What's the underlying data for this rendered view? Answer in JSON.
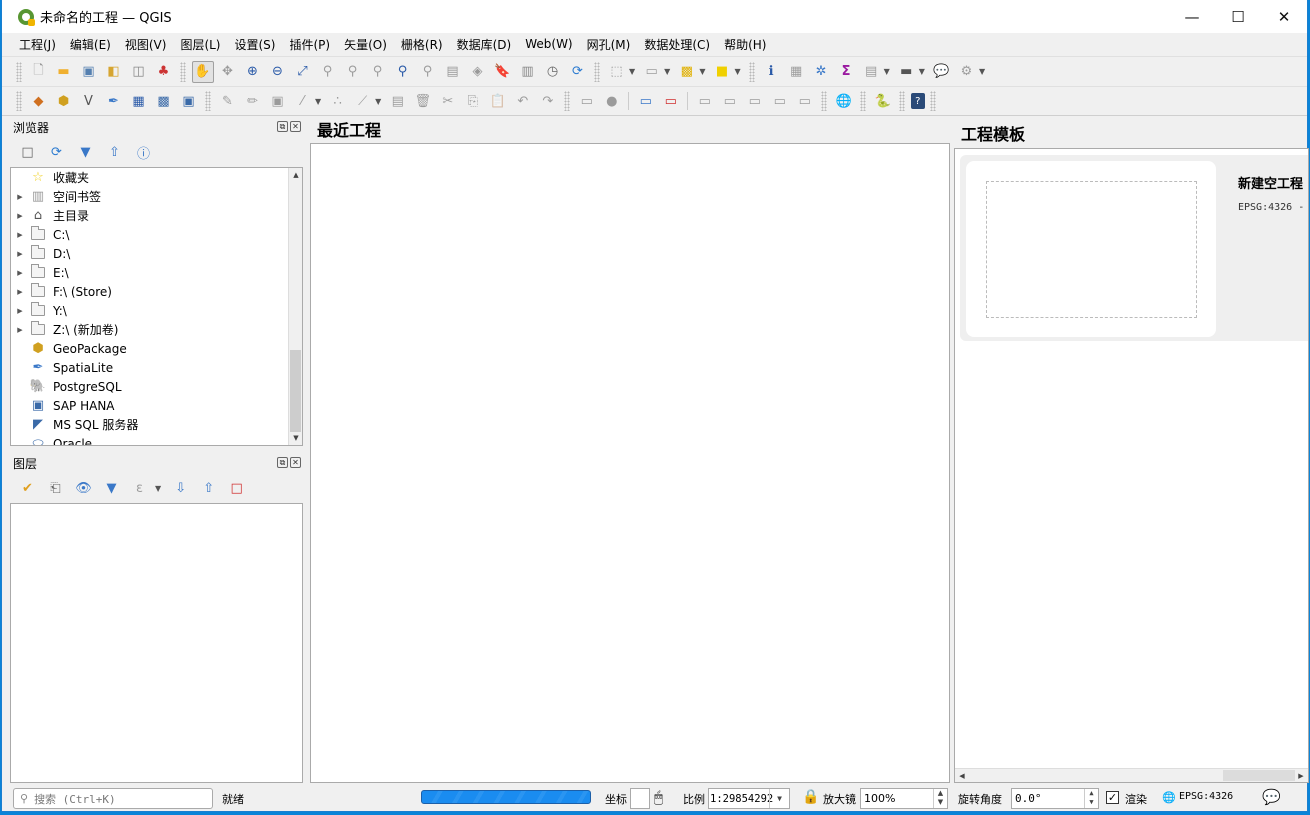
{
  "window": {
    "title": "未命名的工程 — QGIS",
    "controls": {
      "minimize": "—",
      "maximize": "☐",
      "close": "✕"
    }
  },
  "menubar": {
    "items": [
      {
        "label": "工程(J)"
      },
      {
        "label": "编辑(E)"
      },
      {
        "label": "视图(V)"
      },
      {
        "label": "图层(L)"
      },
      {
        "label": "设置(S)"
      },
      {
        "label": "插件(P)"
      },
      {
        "label": "矢量(O)"
      },
      {
        "label": "栅格(R)"
      },
      {
        "label": "数据库(D)"
      },
      {
        "label": "Web(W)"
      },
      {
        "label": "网孔(M)"
      },
      {
        "label": "数据处理(C)"
      },
      {
        "label": "帮助(H)"
      }
    ]
  },
  "toolbar1": {
    "icons": [
      "new-project-icon",
      "open-project-icon",
      "save-project-icon",
      "save-as-icon",
      "print-layout-icon",
      "style-manager-icon",
      "pan-icon",
      "pan-to-selection-icon",
      "zoom-in-icon",
      "zoom-out-icon",
      "zoom-full-icon",
      "zoom-to-selection-icon",
      "zoom-to-layer-icon",
      "zoom-native-icon",
      "zoom-last-icon",
      "zoom-next-icon",
      "new-map-view-icon",
      "new-3d-view-icon",
      "new-bookmark-icon",
      "show-bookmarks-icon",
      "temporal-controller-icon",
      "refresh-icon",
      "select-features-icon",
      "deselect-icon",
      "select-by-location-icon",
      "annotation-icon",
      "identify-icon",
      "attribute-table-icon",
      "processing-toolbox-icon",
      "statistics-icon",
      "open-field-calculator-icon",
      "measure-icon",
      "map-tips-icon",
      "locator-icon"
    ]
  },
  "toolbar2": {
    "icons": [
      "add-vector-layer-icon",
      "add-geopackage-icon",
      "add-delimited-text-icon",
      "add-spatialite-icon",
      "add-mesh-icon",
      "add-raster-icon",
      "add-virtual-layer-icon",
      "current-edits-icon",
      "toggle-editing-icon",
      "save-edits-icon",
      "digitize-icon",
      "add-point-icon",
      "vertex-tool-icon",
      "modify-attributes-icon",
      "delete-selected-icon",
      "cut-features-icon",
      "copy-features-icon",
      "paste-features-icon",
      "undo-icon",
      "redo-icon",
      "label-toolbar-icon",
      "pin-labels-icon",
      "layer-labeling-icon",
      "highlight-labels-icon",
      "show-hide-labels-icon",
      "move-label-icon",
      "rotate-label-icon",
      "change-label-icon",
      "label-properties-icon",
      "metasearch-icon",
      "python-console-icon",
      "help-icon"
    ]
  },
  "browser_panel": {
    "title": "浏览器",
    "items": [
      {
        "label": "收藏夹",
        "icon": "star-icon",
        "expandable": false
      },
      {
        "label": "空间书签",
        "icon": "bookmark-icon",
        "expandable": true
      },
      {
        "label": "主目录",
        "icon": "home-folder-icon",
        "expandable": true
      },
      {
        "label": "C:\\",
        "icon": "folder-icon",
        "expandable": true
      },
      {
        "label": "D:\\",
        "icon": "folder-icon",
        "expandable": true
      },
      {
        "label": "E:\\",
        "icon": "folder-icon",
        "expandable": true
      },
      {
        "label": "F:\\ (Store)",
        "icon": "folder-icon",
        "expandable": true
      },
      {
        "label": "Y:\\",
        "icon": "folder-icon",
        "expandable": true
      },
      {
        "label": "Z:\\ (新加卷)",
        "icon": "folder-icon",
        "expandable": true
      },
      {
        "label": "GeoPackage",
        "icon": "geopackage-icon",
        "expandable": false
      },
      {
        "label": "SpatiaLite",
        "icon": "spatialite-icon",
        "expandable": false
      },
      {
        "label": "PostgreSQL",
        "icon": "postgresql-icon",
        "expandable": false
      },
      {
        "label": "SAP HANA",
        "icon": "sap-hana-icon",
        "expandable": false
      },
      {
        "label": "MS SQL 服务器",
        "icon": "mssql-icon",
        "expandable": false
      },
      {
        "label": "Oracle",
        "icon": "oracle-icon",
        "expandable": false
      }
    ]
  },
  "layers_panel": {
    "title": "图层"
  },
  "recent_projects": {
    "title": "最近工程"
  },
  "project_templates": {
    "title": "工程模板",
    "items": [
      {
        "name": "新建空工程",
        "crs": "EPSG:4326 -"
      }
    ]
  },
  "statusbar": {
    "search_placeholder": "搜索 (Ctrl+K)",
    "status": "就绪",
    "coordinate_label": "坐标",
    "coordinate_value": "",
    "scale_label": "比例",
    "scale_value": "1:29854292",
    "magnifier_label": "放大镜",
    "magnifier_value": "100%",
    "rotation_label": "旋转角度",
    "rotation_value": "0.0°",
    "render_label": "渲染",
    "render_checked": true,
    "crs": "EPSG:4326"
  },
  "colors": {
    "accent": "#0a84d8",
    "progress": "#1a8cf0",
    "qgis_green": "#589632"
  }
}
